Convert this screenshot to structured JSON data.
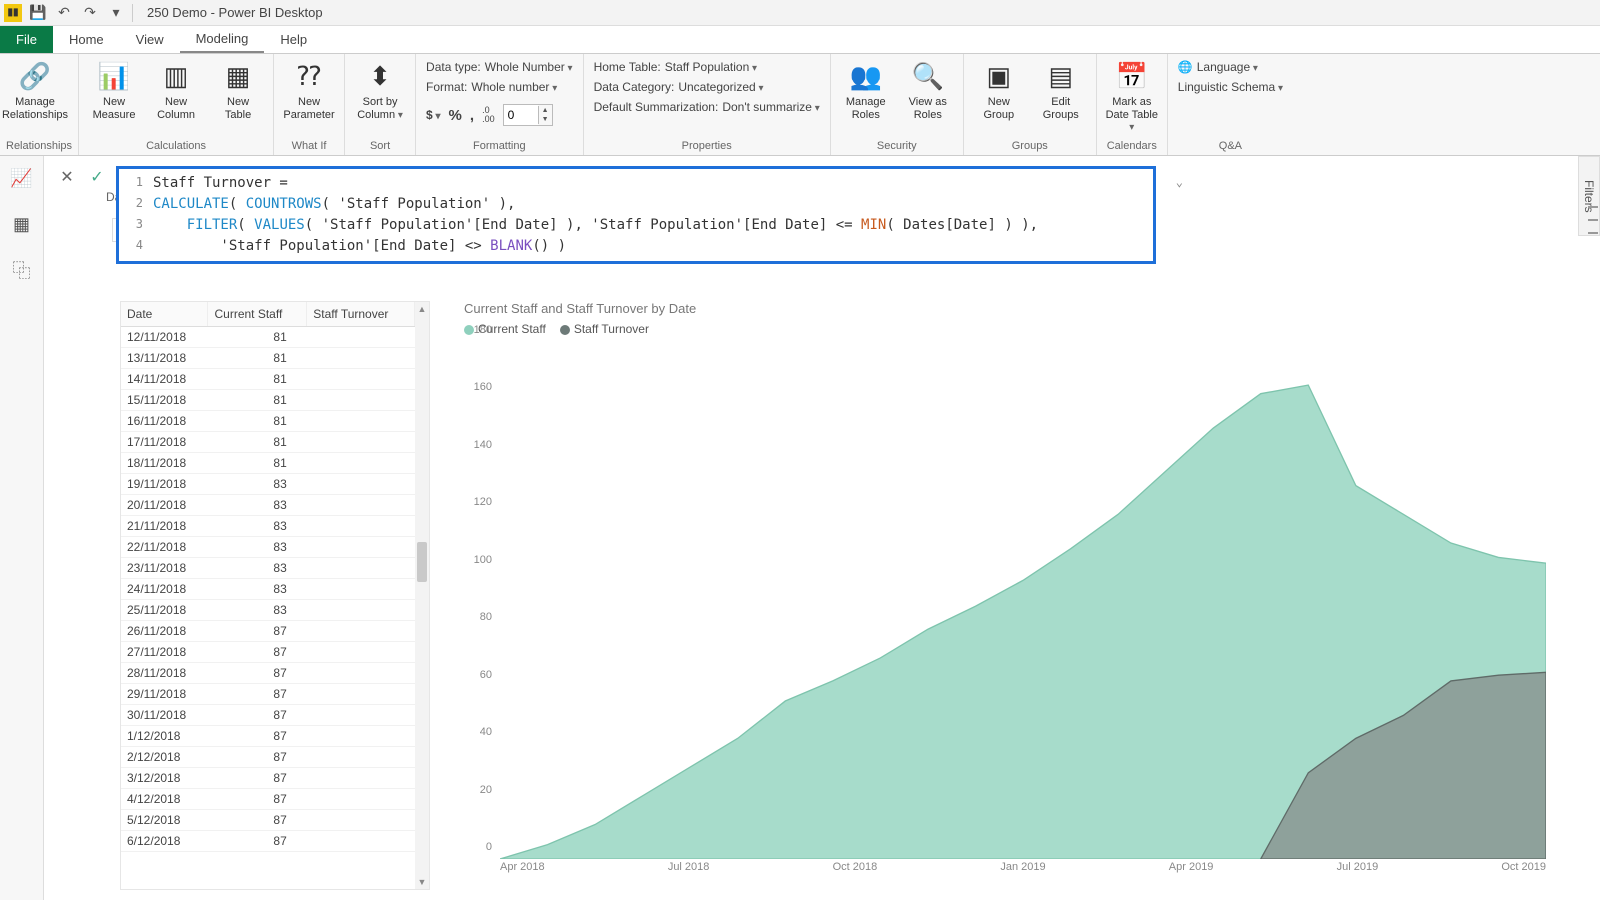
{
  "app": {
    "title": "250 Demo - Power BI Desktop"
  },
  "qat": {
    "save": "Save",
    "undo": "Undo",
    "redo": "Redo"
  },
  "tabs": {
    "file": "File",
    "home": "Home",
    "view": "View",
    "modeling": "Modeling",
    "help": "Help",
    "active": "Modeling"
  },
  "ribbon": {
    "relationships": {
      "manage": "Manage\nRelationships",
      "group": "Relationships"
    },
    "calculations": {
      "measure": "New\nMeasure",
      "column": "New\nColumn",
      "table": "New\nTable",
      "group": "Calculations"
    },
    "whatif": {
      "param": "New\nParameter",
      "group": "What If"
    },
    "sort": {
      "sortby": "Sort by\nColumn",
      "group": "Sort"
    },
    "formatting": {
      "datatype_lbl": "Data type:",
      "datatype_val": "Whole Number",
      "format_lbl": "Format:",
      "format_val": "Whole number",
      "currency": "$",
      "percent": "%",
      "comma": ",",
      "decimals_icon": ".0\n.00",
      "decimals_val": "0",
      "group": "Formatting"
    },
    "properties": {
      "hometable_lbl": "Home Table:",
      "hometable_val": "Staff Population",
      "category_lbl": "Data Category:",
      "category_val": "Uncategorized",
      "summarize_lbl": "Default Summarization:",
      "summarize_val": "Don't summarize",
      "group": "Properties"
    },
    "security": {
      "manage": "Manage\nRoles",
      "view": "View as\nRoles",
      "group": "Security"
    },
    "groups": {
      "new": "New\nGroup",
      "edit": "Edit\nGroups",
      "group": "Groups"
    },
    "calendars": {
      "mark": "Mark as\nDate Table",
      "group": "Calendars"
    },
    "qa": {
      "lang": "Language",
      "schema": "Linguistic Schema",
      "group": "Q&A"
    }
  },
  "leftrail": {
    "report": "Report view",
    "data": "Data view",
    "model": "Model view"
  },
  "behind": {
    "date_lbl": "Date",
    "slicer": "1/0..."
  },
  "formula": {
    "lines": [
      "Staff Turnover =",
      "CALCULATE( COUNTROWS( 'Staff Population' ),",
      "    FILTER( VALUES( 'Staff Population'[End Date] ), 'Staff Population'[End Date] <= MIN( Dates[Date] ) ),",
      "        'Staff Population'[End Date] <> BLANK() )"
    ],
    "cancel": "Cancel",
    "commit": "Commit",
    "expand": "Expand"
  },
  "table": {
    "headers": [
      "Date",
      "Current Staff",
      "Staff Turnover"
    ],
    "rows": [
      [
        "12/11/2018",
        "81",
        ""
      ],
      [
        "13/11/2018",
        "81",
        ""
      ],
      [
        "14/11/2018",
        "81",
        ""
      ],
      [
        "15/11/2018",
        "81",
        ""
      ],
      [
        "16/11/2018",
        "81",
        ""
      ],
      [
        "17/11/2018",
        "81",
        ""
      ],
      [
        "18/11/2018",
        "81",
        ""
      ],
      [
        "19/11/2018",
        "83",
        ""
      ],
      [
        "20/11/2018",
        "83",
        ""
      ],
      [
        "21/11/2018",
        "83",
        ""
      ],
      [
        "22/11/2018",
        "83",
        ""
      ],
      [
        "23/11/2018",
        "83",
        ""
      ],
      [
        "24/11/2018",
        "83",
        ""
      ],
      [
        "25/11/2018",
        "83",
        ""
      ],
      [
        "26/11/2018",
        "87",
        ""
      ],
      [
        "27/11/2018",
        "87",
        ""
      ],
      [
        "28/11/2018",
        "87",
        ""
      ],
      [
        "29/11/2018",
        "87",
        ""
      ],
      [
        "30/11/2018",
        "87",
        ""
      ],
      [
        "1/12/2018",
        "87",
        ""
      ],
      [
        "2/12/2018",
        "87",
        ""
      ],
      [
        "3/12/2018",
        "87",
        ""
      ],
      [
        "4/12/2018",
        "87",
        ""
      ],
      [
        "5/12/2018",
        "87",
        ""
      ],
      [
        "6/12/2018",
        "87",
        ""
      ]
    ]
  },
  "chart_data": {
    "type": "area",
    "title": "Current Staff and Staff Turnover by Date",
    "xlabel": "",
    "ylabel": "",
    "ylim": [
      0,
      180
    ],
    "yticks": [
      0,
      20,
      40,
      60,
      80,
      100,
      120,
      140,
      160,
      180
    ],
    "xticks": [
      "Apr 2018",
      "Jul 2018",
      "Oct 2018",
      "Jan 2019",
      "Apr 2019",
      "Jul 2019",
      "Oct 2019"
    ],
    "legend": [
      {
        "name": "Current Staff",
        "color": "#8fd0bd"
      },
      {
        "name": "Staff Turnover",
        "color": "#6d7a78"
      }
    ],
    "x_range": [
      "2018-02",
      "2019-12"
    ],
    "series": [
      {
        "name": "Current Staff",
        "points": [
          [
            "2018-02",
            0
          ],
          [
            "2018-03",
            5
          ],
          [
            "2018-04",
            12
          ],
          [
            "2018-05",
            22
          ],
          [
            "2018-06",
            32
          ],
          [
            "2018-07",
            42
          ],
          [
            "2018-08",
            55
          ],
          [
            "2018-09",
            62
          ],
          [
            "2018-10",
            70
          ],
          [
            "2018-11",
            80
          ],
          [
            "2018-12",
            88
          ],
          [
            "2019-01",
            97
          ],
          [
            "2019-02",
            108
          ],
          [
            "2019-03",
            120
          ],
          [
            "2019-04",
            135
          ],
          [
            "2019-05",
            150
          ],
          [
            "2019-06",
            162
          ],
          [
            "2019-07",
            165
          ],
          [
            "2019-08",
            130
          ],
          [
            "2019-09",
            120
          ],
          [
            "2019-10",
            110
          ],
          [
            "2019-11",
            105
          ],
          [
            "2019-12",
            103
          ]
        ]
      },
      {
        "name": "Staff Turnover",
        "points": [
          [
            "2019-06",
            0
          ],
          [
            "2019-07",
            30
          ],
          [
            "2019-08",
            42
          ],
          [
            "2019-09",
            50
          ],
          [
            "2019-10",
            62
          ],
          [
            "2019-11",
            64
          ],
          [
            "2019-12",
            65
          ]
        ]
      }
    ]
  },
  "filters": {
    "label": "Filters"
  }
}
